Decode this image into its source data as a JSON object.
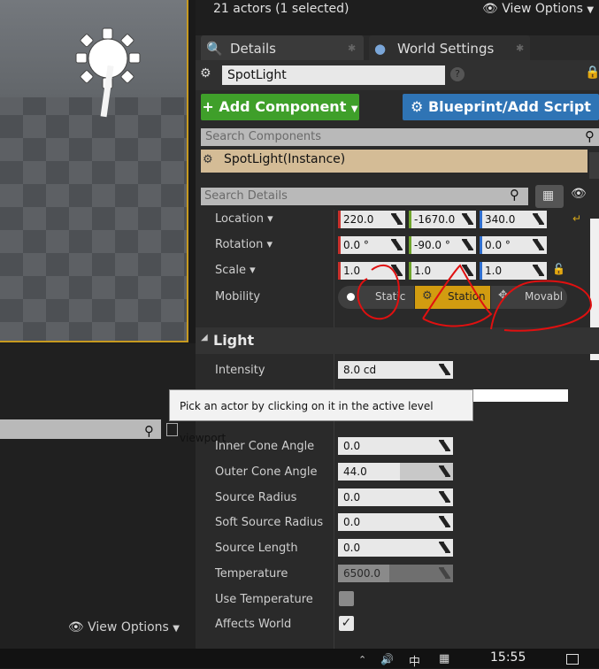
{
  "header": {
    "actor_count": "21 actors (1 selected)",
    "view_options": "View Options"
  },
  "tabs": [
    {
      "label": "Details"
    },
    {
      "label": "World Settings"
    }
  ],
  "details": {
    "actor_name": "SpotLight",
    "add_component": "Add Component",
    "blueprint": "Blueprint/Add Script",
    "search_components_placeholder": "Search Components",
    "component_instance": "SpotLight(Instance)",
    "search_details_placeholder": "Search Details"
  },
  "transform": {
    "location": {
      "label": "Location",
      "x": "220.0",
      "y": "-1670.0",
      "z": "340.0"
    },
    "rotation": {
      "label": "Rotation",
      "x": "0.0 °",
      "y": "-90.0 °",
      "z": "0.0 °"
    },
    "scale": {
      "label": "Scale",
      "x": "1.0",
      "y": "1.0",
      "z": "1.0"
    },
    "mobility": {
      "label": "Mobility",
      "options": [
        "Static",
        "Station",
        "Movabl"
      ],
      "selected": "Station"
    }
  },
  "light": {
    "section_title": "Light",
    "rows": [
      {
        "label": "Intensity",
        "value": "8.0 cd"
      },
      {
        "label": "Inner Cone Angle",
        "value": "0.0"
      },
      {
        "label": "Outer Cone Angle",
        "value": "44.0"
      },
      {
        "label": "Source Radius",
        "value": "0.0"
      },
      {
        "label": "Soft Source Radius",
        "value": "0.0"
      },
      {
        "label": "Source Length",
        "value": "0.0"
      },
      {
        "label": "Temperature",
        "value": "6500.0"
      },
      {
        "label": "Use Temperature",
        "checked": false
      },
      {
        "label": "Affects World",
        "checked": true
      }
    ]
  },
  "tooltip": "Pick an actor by clicking on it in the active level viewport",
  "left_panel": {
    "view_options": "View Options"
  },
  "taskbar": {
    "time": "15:55",
    "ime": "中"
  },
  "colors": {
    "add_component_bg": "#3f9f2a",
    "blueprint_bg": "#2f74b5",
    "selected_mobility": "#d29c10",
    "axis_x": "#c8302c",
    "axis_y": "#6fa42c",
    "axis_z": "#2f6fd0",
    "annotation": "#e01010"
  }
}
